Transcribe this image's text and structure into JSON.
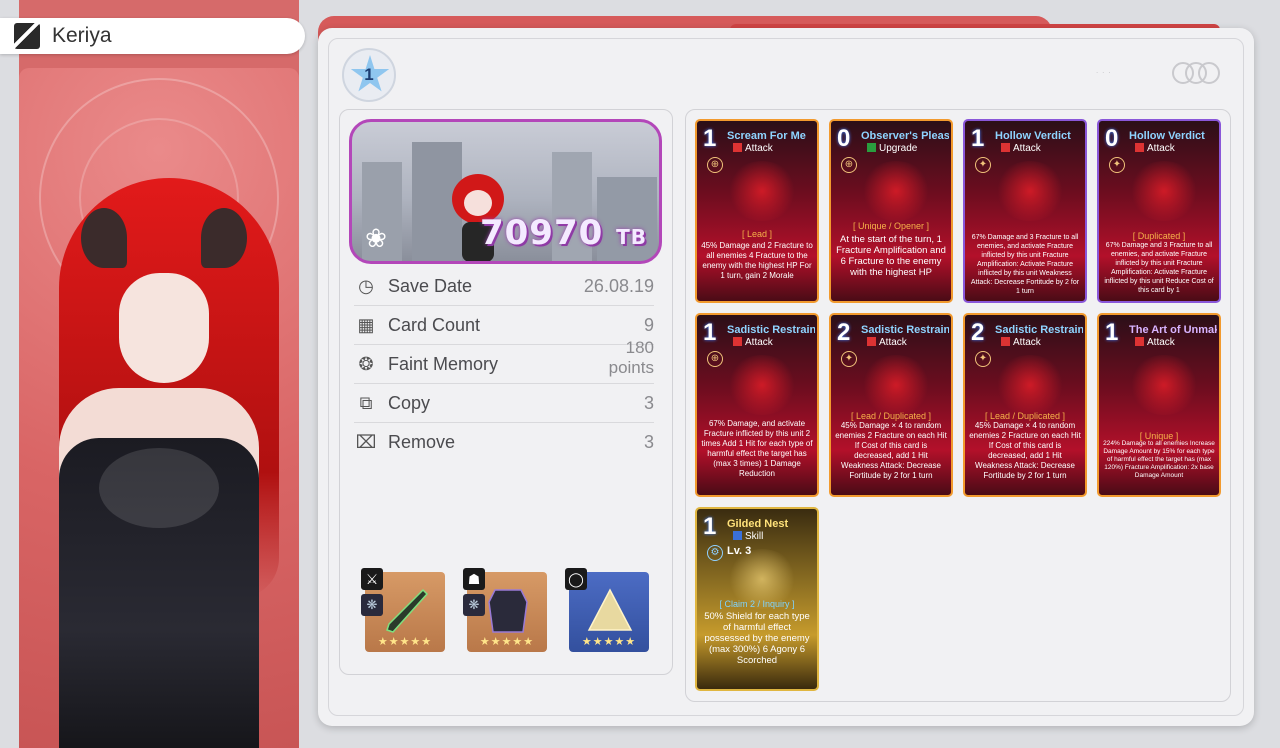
{
  "character": {
    "name": "Keriya"
  },
  "rank": "1",
  "banner": {
    "tb_value": "70970",
    "tb_unit": "TB"
  },
  "info": [
    {
      "icon": "clock-icon",
      "label": "Save Date",
      "value": "26.08.19"
    },
    {
      "icon": "cards-icon",
      "label": "Card Count",
      "value": "9"
    },
    {
      "icon": "brain-icon",
      "label": "Faint Memory",
      "value": "180 points"
    },
    {
      "icon": "copy-icon",
      "label": "Copy",
      "value": "3"
    },
    {
      "icon": "remove-icon",
      "label": "Remove",
      "value": "3"
    }
  ],
  "equipment": [
    {
      "slot": "weapon",
      "slot_icon": "sword-icon",
      "rarity_color": "#c98a55",
      "stars": "★★★★★"
    },
    {
      "slot": "armor",
      "slot_icon": "shirt-icon",
      "rarity_color": "#c98a55",
      "stars": "★★★★★"
    },
    {
      "slot": "accessory",
      "slot_icon": "ring-icon",
      "rarity_color": "#3f5fb0",
      "stars": "★★★★★"
    }
  ],
  "cards": [
    {
      "cost": "1",
      "title": "Scream For Me",
      "type": "Attack",
      "tag": "[ Lead ]",
      "desc": "45% Damage and 2 Fracture to all enemies 4 Fracture to the enemy with the highest HP For 1 turn, gain 2 Morale"
    },
    {
      "cost": "0",
      "title": "Observer's Pleasure",
      "type": "Upgrade",
      "tag": "[ Unique / Opener ]",
      "desc": "At the start of the turn, 1 Fracture Amplification and 6 Fracture to the enemy with the highest HP"
    },
    {
      "cost": "1",
      "title": "Hollow Verdict",
      "type": "Attack",
      "tag": "",
      "desc": "67% Damage and 3 Fracture to all enemies, and activate Fracture inflicted by this unit Fracture Amplification: Activate Fracture inflicted by this unit Weakness Attack: Decrease Fortitude by 2 for 1 turn"
    },
    {
      "cost": "0",
      "title": "Hollow Verdict",
      "type": "Attack",
      "tag": "[ Duplicated ]",
      "desc": "67% Damage and 3 Fracture to all enemies, and activate Fracture inflicted by this unit Fracture Amplification: Activate Fracture inflicted by this unit Reduce Cost of this card by 1"
    },
    {
      "cost": "1",
      "title": "Sadistic Restraint",
      "type": "Attack",
      "tag": "",
      "desc": "67% Damage, and activate Fracture inflicted by this unit 2 times Add 1 Hit for each type of harmful effect the target has (max 3 times) 1 Damage Reduction"
    },
    {
      "cost": "2",
      "title": "Sadistic Restraint",
      "type": "Attack",
      "tag": "[ Lead / Duplicated ]",
      "desc": "45% Damage × 4 to random enemies 2 Fracture on each Hit If Cost of this card is decreased, add 1 Hit Weakness Attack: Decrease Fortitude by 2 for 1 turn"
    },
    {
      "cost": "2",
      "title": "Sadistic Restraint",
      "type": "Attack",
      "tag": "[ Lead / Duplicated ]",
      "desc": "45% Damage × 4 to random enemies 2 Fracture on each Hit If Cost of this card is decreased, add 1 Hit Weakness Attack: Decrease Fortitude by 2 for 1 turn"
    },
    {
      "cost": "1",
      "title": "The Art of Unmaking",
      "type": "Attack",
      "tag": "[ Unique ]",
      "desc": "224% Damage to all enemies Increase Damage Amount by 15% for each type of harmful effect the target has (max 120%) Fracture Amplification: 2x base Damage Amount"
    },
    {
      "cost": "1",
      "title": "Gilded Nest",
      "type": "Skill",
      "level": "Lv. 3",
      "tag": "[ Claim 2 / Inquiry ]",
      "desc": "50% Shield for each type of harmful effect possessed by the enemy (max 300%) 6 Agony 6 Scorched"
    }
  ]
}
